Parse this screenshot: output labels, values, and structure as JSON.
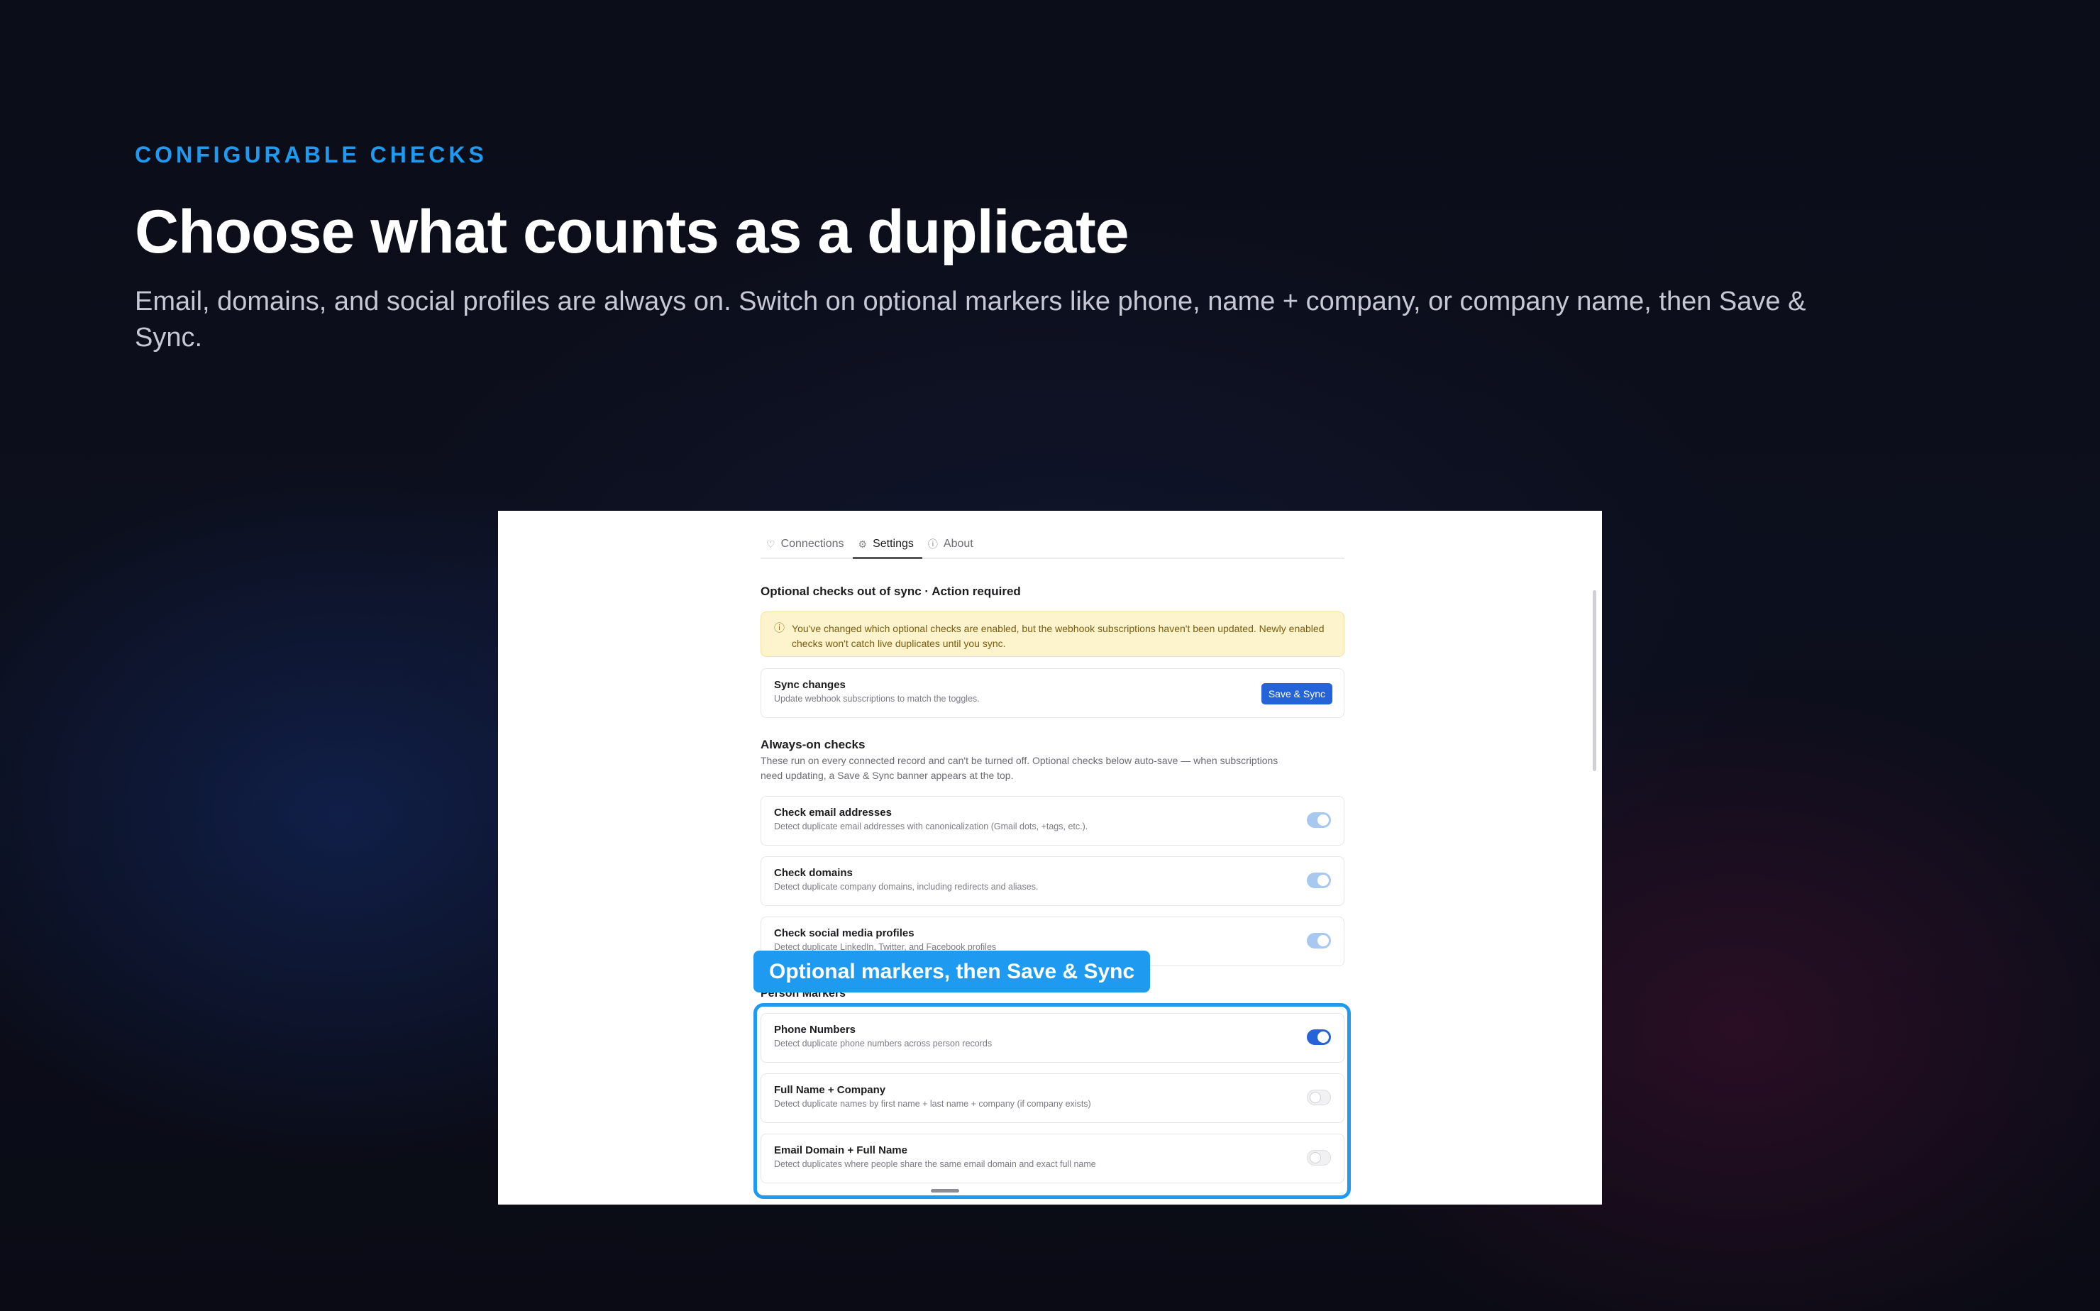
{
  "hero": {
    "eyebrow": "CONFIGURABLE CHECKS",
    "headline": "Choose what counts as a duplicate",
    "subhead": "Email, domains, and social profiles are always on. Switch on optional markers like phone, name + company, or company name, then Save & Sync."
  },
  "tabs": [
    {
      "label": "Connections",
      "icon": "heart-icon"
    },
    {
      "label": "Settings",
      "icon": "gear-icon",
      "active": true
    },
    {
      "label": "About",
      "icon": "info-icon"
    }
  ],
  "sync_alert": {
    "title": "Optional checks out of sync · Action required",
    "message": "You've changed which optional checks are enabled, but the webhook subscriptions haven't been updated. Newly enabled checks won't catch live duplicates until you sync."
  },
  "sync_card": {
    "title": "Sync changes",
    "desc": "Update webhook subscriptions to match the toggles.",
    "button": "Save & Sync"
  },
  "always_on": {
    "title": "Always-on checks",
    "desc": "These run on every connected record and can't be turned off. Optional checks below auto-save — when subscriptions need updating, a Save & Sync banner appears at the top.",
    "items": [
      {
        "title": "Check email addresses",
        "desc": "Detect duplicate email addresses with canonicalization (Gmail dots, +tags, etc.).",
        "state": "locked-on"
      },
      {
        "title": "Check domains",
        "desc": "Detect duplicate company domains, including redirects and aliases.",
        "state": "locked-on"
      },
      {
        "title": "Check social media profiles",
        "desc": "Detect duplicate LinkedIn, Twitter, and Facebook profiles",
        "state": "locked-on"
      }
    ]
  },
  "person_markers": {
    "title": "Person Markers",
    "items": [
      {
        "title": "Phone Numbers",
        "desc": "Detect duplicate phone numbers across person records",
        "enabled": true
      },
      {
        "title": "Full Name + Company",
        "desc": "Detect duplicate names by first name + last name + company (if company exists)",
        "enabled": false
      },
      {
        "title": "Email Domain + Full Name",
        "desc": "Detect duplicates where people share the same email domain and exact full name",
        "enabled": false
      }
    ]
  },
  "callout": "Optional markers, then Save & Sync",
  "colors": {
    "accent": "#1e9bf0",
    "primary_button": "#2563d8",
    "warning_bg": "#fdf3cc"
  }
}
